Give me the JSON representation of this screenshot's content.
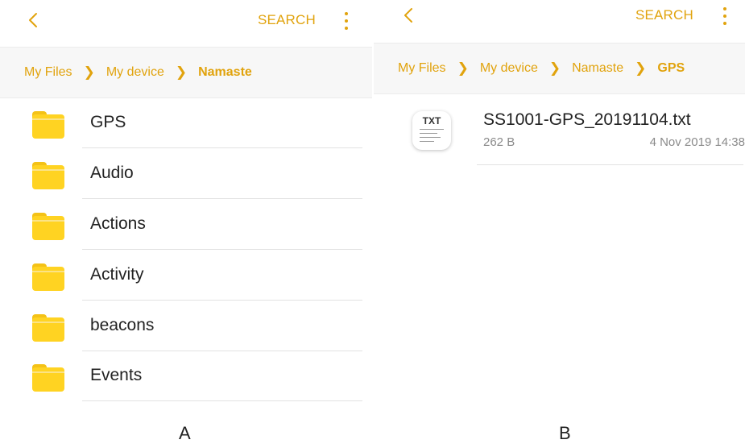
{
  "panel_a": {
    "search_label": "SEARCH",
    "breadcrumb": [
      "My Files",
      "My device",
      "Namaste"
    ],
    "folders": [
      "GPS",
      "Audio",
      "Actions",
      "Activity",
      "beacons",
      "Events"
    ]
  },
  "panel_b": {
    "search_label": "SEARCH",
    "breadcrumb": [
      "My Files",
      "My device",
      "Namaste",
      "GPS"
    ],
    "file": {
      "icon_label": "TXT",
      "name": "SS1001-GPS_20191104.txt",
      "size": "262 B",
      "date": "4 Nov 2019 14:38"
    }
  },
  "captions": {
    "a": "A",
    "b": "B"
  },
  "icons": {
    "back": "chevron-left-icon",
    "more": "more-vertical-icon",
    "folder": "folder-icon",
    "file": "txt-file-icon"
  },
  "colors": {
    "accent": "#e1a30d",
    "folder": "#ffd322",
    "breadcrumb_bg": "#f7f7f7"
  }
}
